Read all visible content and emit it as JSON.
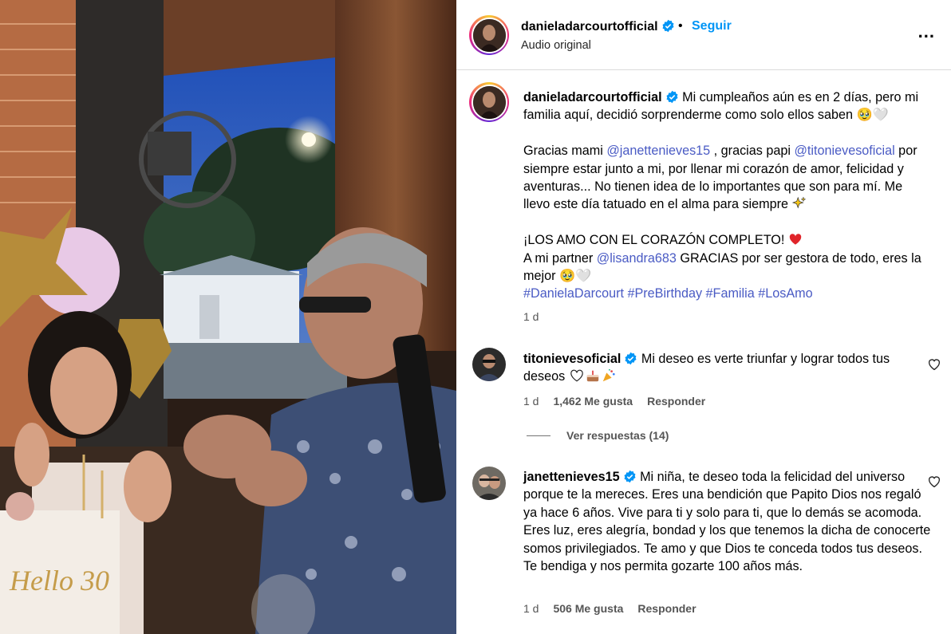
{
  "post": {
    "username": "danieladarcourtofficial",
    "subtitle": "Audio original",
    "follow_label": "Seguir",
    "separator": "•",
    "more_label": "...",
    "caption": {
      "line1": "Mi cumpleaños aún es en 2 días, pero mi familia aquí, decidió sorprenderme como solo ellos saben 🥹🤍",
      "p2_a": "Gracias mami ",
      "p2_mention1": "@janettenieves15",
      "p2_b": " , gracias papi ",
      "p2_mention2": "@titonievesoficial",
      "p2_c": " por siempre estar junto a mi, por llenar mi corazón de amor, felicidad y aventuras... No tienen idea de lo importantes que son para mí. Me llevo este día tatuado en el alma para siempre ",
      "p3_a": "¡LOS AMO CON EL CORAZÓN COMPLETO! ",
      "p3_b": "A mi partner ",
      "p3_mention": "@lisandra683",
      "p3_c": " GRACIAS por ser gestora de todo, eres la mejor 🥹🤍",
      "hashtags": [
        "#DanielaDarcourt",
        "#PreBirthday",
        "#Familia",
        "#LosAmo"
      ]
    },
    "time": "1 d"
  },
  "comments": [
    {
      "username": "titonievesoficial",
      "text": "Mi deseo es verte triunfar y lograr todos tus deseos",
      "time": "1 d",
      "likes": "1,462 Me gusta",
      "reply": "Responder",
      "view_replies": "Ver respuestas (14)"
    },
    {
      "username": "janettenieves15",
      "text": "Mi niña, te deseo toda la felicidad del universo porque te la mereces. Eres una bendición que Papito Dios nos regaló ya hace 6 años. Vive para ti y solo para ti, que lo demás se acomoda. Eres luz, eres alegría, bondad y los que tenemos la dicha de conocerte somos privilegiados. Te amo y que Dios te conceda todos tus deseos. Te bendiga y nos permita gozarte 100 años más.",
      "time": "1 d",
      "likes": "506 Me gusta",
      "reply": "Responder"
    }
  ],
  "colors": {
    "link": "#0095f6",
    "mention": "#4a5bc4",
    "verified": "#0095f6",
    "secondary": "#555555"
  },
  "icons": [
    "verified-badge-icon",
    "more-options-icon",
    "heart-outline-icon",
    "sparkles-icon",
    "red-heart-icon"
  ],
  "media": {
    "cake_text": "Hello 30"
  }
}
